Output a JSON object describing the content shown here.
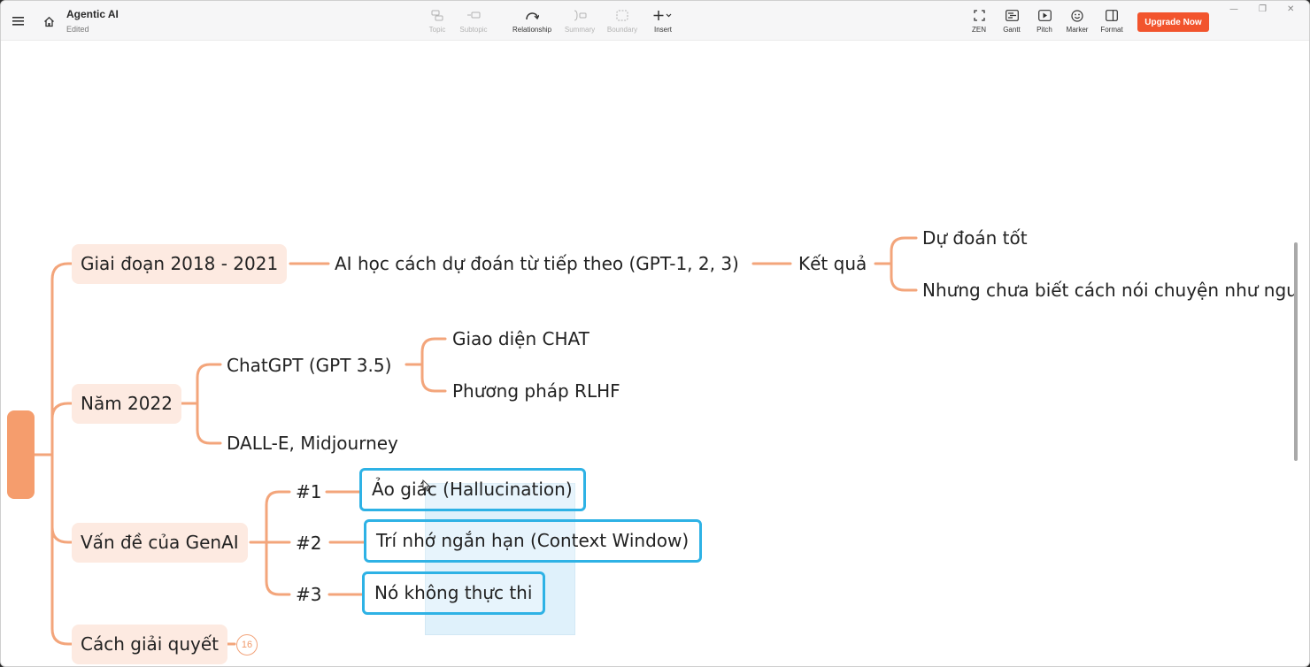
{
  "header": {
    "doc_title": "Agentic AI",
    "doc_status": "Edited",
    "tools": [
      {
        "icon": "topic-icon",
        "label": "Topic",
        "enabled": false
      },
      {
        "icon": "subtopic-icon",
        "label": "Subtopic",
        "enabled": false
      },
      {
        "icon": "relationship-icon",
        "label": "Relationship",
        "enabled": true
      },
      {
        "icon": "summary-icon",
        "label": "Summary",
        "enabled": false
      },
      {
        "icon": "boundary-icon",
        "label": "Boundary",
        "enabled": false
      },
      {
        "icon": "insert-icon",
        "label": "Insert",
        "enabled": true
      }
    ],
    "right_tools": [
      {
        "icon": "zen-icon",
        "label": "ZEN"
      },
      {
        "icon": "gantt-icon",
        "label": "Gantt"
      },
      {
        "icon": "pitch-icon",
        "label": "Pitch"
      },
      {
        "icon": "marker-icon",
        "label": "Marker"
      },
      {
        "icon": "format-icon",
        "label": "Format"
      }
    ],
    "upgrade_label": "Upgrade Now",
    "accent": "#f2542d"
  },
  "mindmap": {
    "branch_color": "#f3a57b",
    "selection_color": "#2eb2e5",
    "branches": [
      {
        "label": "Giai đoạn 2018 - 2021",
        "child": "AI học cách dự đoán từ tiếp theo (GPT-1, 2, 3)",
        "grandchild": "Kết quả",
        "leaves": [
          "Dự đoán tốt",
          "Nhưng chưa biết cách nói chuyện như ngu"
        ]
      },
      {
        "label": "Năm 2022",
        "children": [
          {
            "label": "ChatGPT (GPT 3.5)",
            "leaves": [
              "Giao diện CHAT",
              "Phương pháp RLHF"
            ]
          },
          {
            "label": "DALL-E, Midjourney"
          }
        ]
      },
      {
        "label": "Vấn đề của GenAI",
        "children": [
          {
            "label": "#1",
            "leaf": "Ảo giác (Hallucination)"
          },
          {
            "label": "#2",
            "leaf": "Trí nhớ ngắn hạn (Context Window)"
          },
          {
            "label": "#3",
            "leaf": "Nó không thực thi"
          }
        ]
      },
      {
        "label": "Cách giải quyết",
        "collapsed_count": "16"
      }
    ]
  }
}
